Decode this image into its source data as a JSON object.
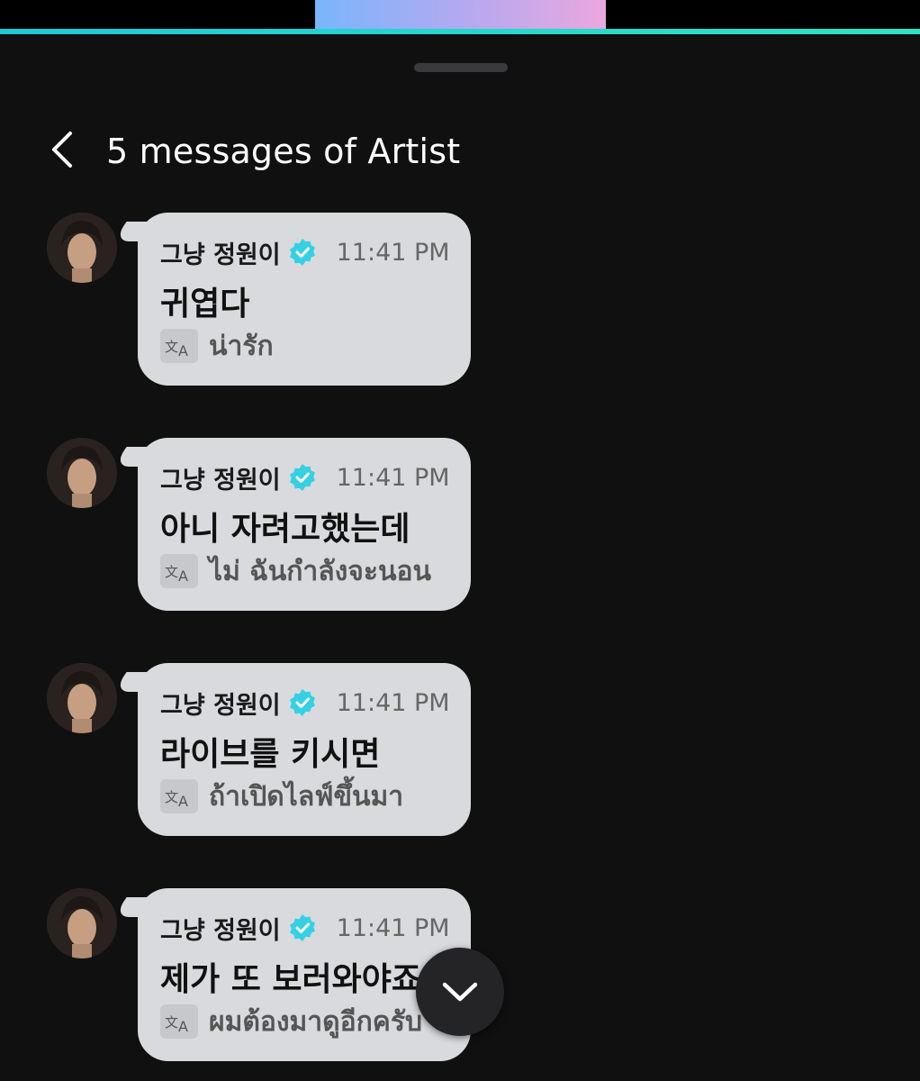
{
  "header": {
    "title": "5 messages of Artist",
    "back_icon": "chevron-left-icon"
  },
  "colors": {
    "background": "#101011",
    "bubble": "#d9dadd",
    "verified": "#35d0e4",
    "accent_line": "#2ee3c2"
  },
  "messages": [
    {
      "name": "그냥 정원이",
      "time": "11:41 PM",
      "text": "귀엽다",
      "translation": "น่ารัก"
    },
    {
      "name": "그냥 정원이",
      "time": "11:41 PM",
      "text": "아니 자려고했는데",
      "translation": "ไม่ ฉันกำลังจะนอน"
    },
    {
      "name": "그냥 정원이",
      "time": "11:41 PM",
      "text": "라이브를 키시면",
      "translation": "ถ้าเปิดไลฟ์ขึ้นมา"
    },
    {
      "name": "그냥 정원이",
      "time": "11:41 PM",
      "text": "제가 또 보러와야죠",
      "translation": "ผมต้องมาดูอีกครับ"
    }
  ],
  "scroll_button_icon": "chevron-down-icon"
}
